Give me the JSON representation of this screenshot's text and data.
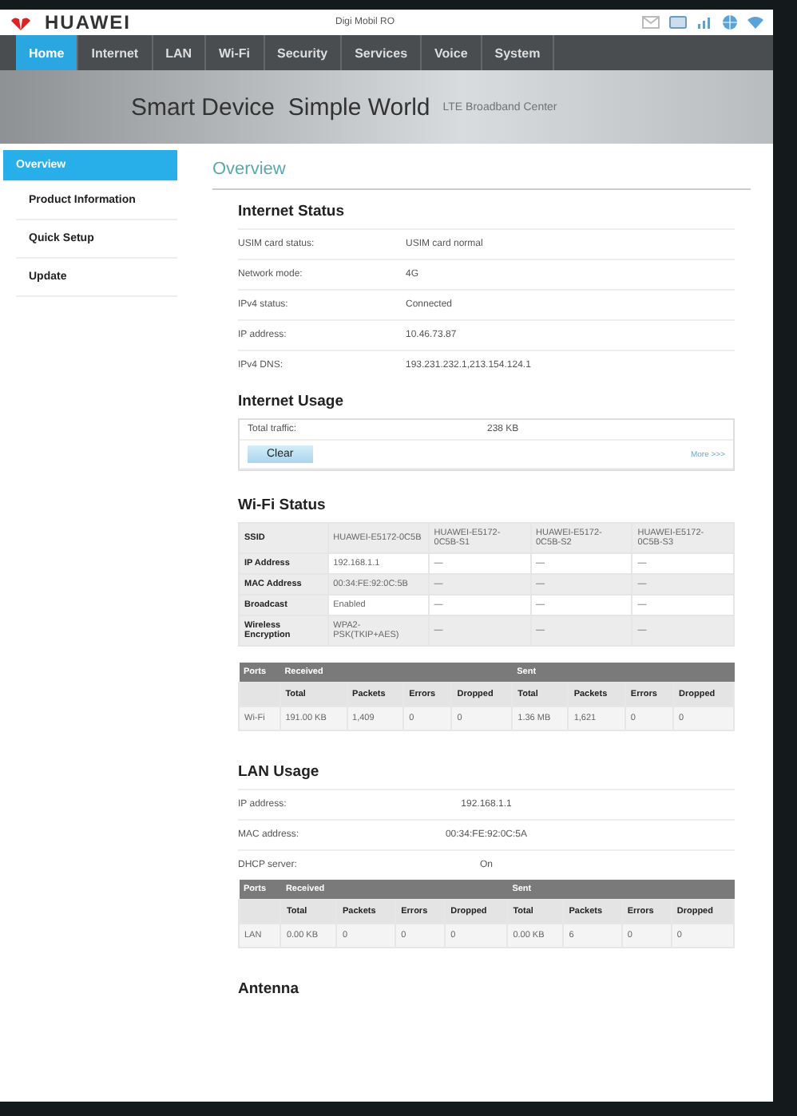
{
  "header": {
    "brand": "HUAWEI",
    "operator": "Digi Mobil RO"
  },
  "nav": [
    {
      "label": "Home",
      "selected": true
    },
    {
      "label": "Internet",
      "selected": false
    },
    {
      "label": "LAN",
      "selected": false
    },
    {
      "label": "Wi-Fi",
      "selected": false
    },
    {
      "label": "Security",
      "selected": false
    },
    {
      "label": "Services",
      "selected": false
    },
    {
      "label": "Voice",
      "selected": false
    },
    {
      "label": "System",
      "selected": false
    }
  ],
  "banner": {
    "slogan": "Smart Device  Simple World",
    "subtitle": "LTE Broadband Center"
  },
  "sidebar": [
    {
      "label": "Overview",
      "selected": true
    },
    {
      "label": "Product Information",
      "selected": false
    },
    {
      "label": "Quick Setup",
      "selected": false
    },
    {
      "label": "Update",
      "selected": false
    }
  ],
  "page_title": "Overview",
  "internet_status": {
    "title": "Internet Status",
    "rows": [
      {
        "label": "USIM card status:",
        "value": "USIM card normal"
      },
      {
        "label": "Network mode:",
        "value": "4G"
      },
      {
        "label": "IPv4 status:",
        "value": "Connected"
      },
      {
        "label": "IP address:",
        "value": "10.46.73.87"
      },
      {
        "label": "IPv4 DNS:",
        "value": "193.231.232.1,213.154.124.1"
      }
    ]
  },
  "internet_usage": {
    "title": "Internet Usage",
    "label": "Total traffic:",
    "value": "238 KB",
    "clear_button": "Clear",
    "more_link": "More >>>"
  },
  "wifi_status": {
    "title": "Wi-Fi Status",
    "rows": [
      [
        "SSID",
        "HUAWEI-E5172-0C5B",
        "HUAWEI-E5172-0C5B-S1",
        "HUAWEI-E5172-0C5B-S2",
        "HUAWEI-E5172-0C5B-S3"
      ],
      [
        "IP Address",
        "192.168.1.1",
        "—",
        "—",
        "—"
      ],
      [
        "MAC Address",
        "00:34:FE:92:0C:5B",
        "—",
        "—",
        "—"
      ],
      [
        "Broadcast",
        "Enabled",
        "—",
        "—",
        "—"
      ],
      [
        "Wireless Encryption",
        "WPA2-PSK(TKIP+AES)",
        "—",
        "—",
        "—"
      ]
    ],
    "traffic": {
      "groups": [
        "Ports",
        "Received",
        "Sent"
      ],
      "columns": [
        "",
        "Total",
        "Packets",
        "Errors",
        "Dropped",
        "Total",
        "Packets",
        "Errors",
        "Dropped"
      ],
      "rows": [
        [
          "Wi-Fi",
          "191.00 KB",
          "1,409",
          "0",
          "0",
          "1.36 MB",
          "1,621",
          "0",
          "0"
        ]
      ]
    }
  },
  "lan_usage": {
    "title": "LAN Usage",
    "rows": [
      {
        "label": "IP address:",
        "value": "192.168.1.1"
      },
      {
        "label": "MAC address:",
        "value": "00:34:FE:92:0C:5A"
      },
      {
        "label": "DHCP server:",
        "value": "On"
      }
    ],
    "traffic": {
      "groups": [
        "Ports",
        "Received",
        "Sent"
      ],
      "columns": [
        "",
        "Total",
        "Packets",
        "Errors",
        "Dropped",
        "Total",
        "Packets",
        "Errors",
        "Dropped"
      ],
      "rows": [
        [
          "LAN",
          "0.00 KB",
          "0",
          "0",
          "0",
          "0.00 KB",
          "6",
          "0",
          "0"
        ]
      ]
    }
  },
  "antenna": {
    "title": "Antenna"
  }
}
